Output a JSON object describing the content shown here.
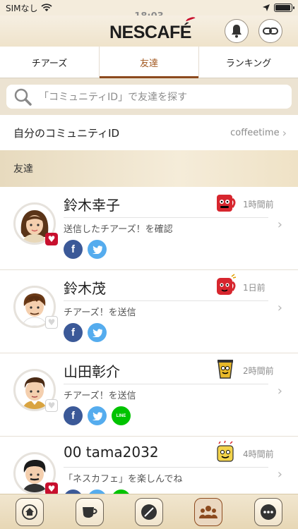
{
  "statusbar": {
    "carrier": "SIMなし",
    "time": "18:03"
  },
  "header": {
    "logo": "NESCAFÉ",
    "logo_main": "NESCAF",
    "logo_accent": "É",
    "icons": [
      "bell-icon",
      "link-icon"
    ]
  },
  "tabs": [
    {
      "label": "チアーズ",
      "active": false
    },
    {
      "label": "友達",
      "active": true
    },
    {
      "label": "ランキング",
      "active": false
    }
  ],
  "search": {
    "placeholder": "「コミュニティID」で友達を探す"
  },
  "community": {
    "label": "自分のコミュニティID",
    "value": "coffeetime",
    "chevron": "›"
  },
  "section": {
    "title": "友達"
  },
  "friends": [
    {
      "name": "鈴木幸子",
      "time": "1時間前",
      "message": "送信したチアーズ！を確認",
      "heart": true,
      "sticker": "red-mug-sticker",
      "socials": [
        "facebook",
        "twitter"
      ]
    },
    {
      "name": "鈴木茂",
      "time": "1日前",
      "message": "チアーズ！を送信",
      "heart": false,
      "sticker": "red-mug-sticker",
      "socials": [
        "facebook",
        "twitter"
      ]
    },
    {
      "name": "山田彰介",
      "time": "2時間前",
      "message": "チアーズ！を送信",
      "heart": false,
      "sticker": "coffee-cup-sticker",
      "socials": [
        "facebook",
        "twitter",
        "line"
      ]
    },
    {
      "name": "00 tama2032",
      "time": "4時間前",
      "message": "「ネスカフェ」を楽しんでね",
      "heart": true,
      "sticker": "yellow-mug-sticker",
      "socials": [
        "facebook",
        "twitter",
        "line"
      ]
    }
  ],
  "social_labels": {
    "facebook": "f",
    "twitter": "t",
    "line": "LINE"
  },
  "bottom_nav": [
    {
      "icon": "home-icon",
      "active": false
    },
    {
      "icon": "cup-icon",
      "active": false
    },
    {
      "icon": "bean-icon",
      "active": false
    },
    {
      "icon": "friends-icon",
      "active": true
    },
    {
      "icon": "more-icon",
      "active": false
    }
  ],
  "colors": {
    "accent": "#8c4a1e",
    "heart": "#c8102e",
    "background": "#f4ecdc"
  }
}
